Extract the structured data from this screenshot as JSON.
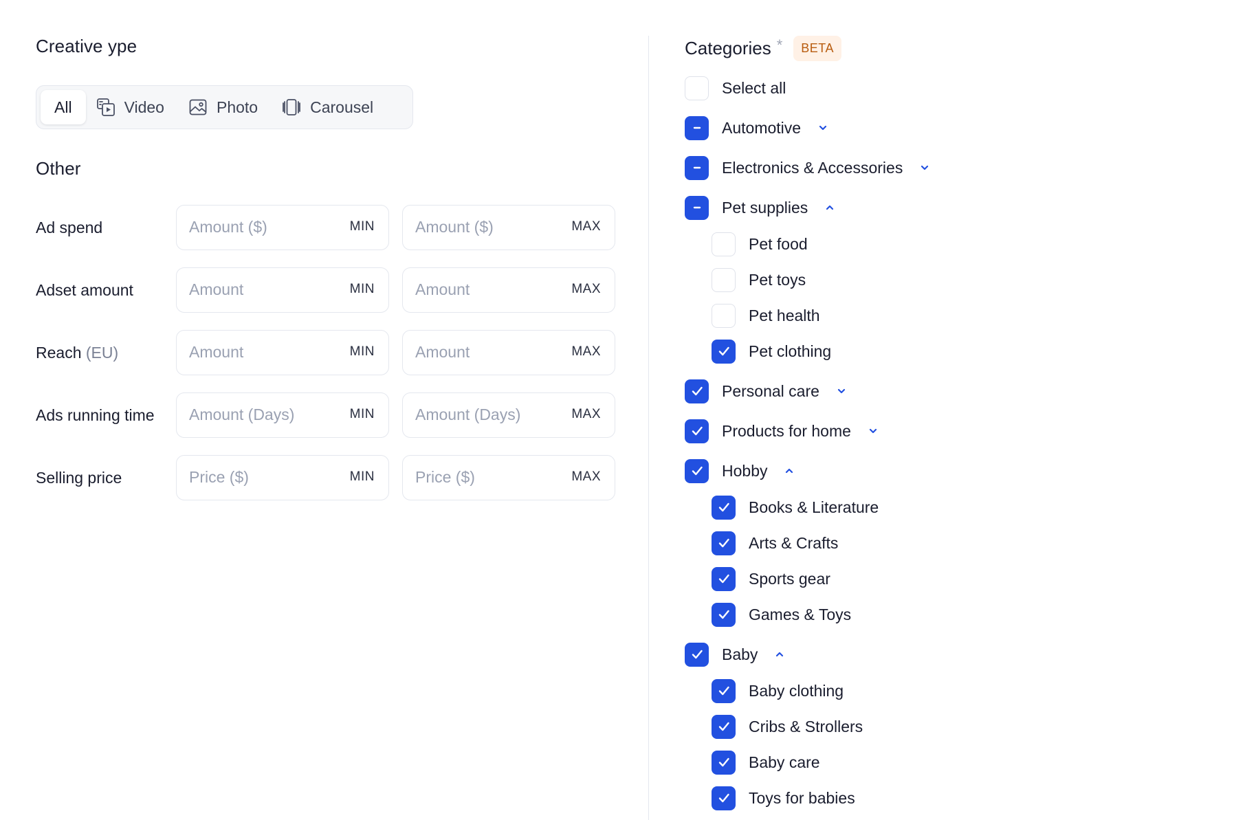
{
  "creative_type": {
    "title": "Creative ype",
    "options": [
      {
        "label": "All",
        "icon": "all",
        "active": true
      },
      {
        "label": "Video",
        "icon": "video-icon",
        "active": false
      },
      {
        "label": "Photo",
        "icon": "photo-icon",
        "active": false
      },
      {
        "label": "Carousel",
        "icon": "carousel-icon",
        "active": false
      }
    ]
  },
  "other": {
    "title": "Other",
    "rows": [
      {
        "label": "Ad spend",
        "label_suffix": "",
        "min_placeholder": "Amount ($)",
        "max_placeholder": "Amount ($)",
        "min_tag": "MIN",
        "max_tag": "MAX"
      },
      {
        "label": "Adset amount",
        "label_suffix": "",
        "min_placeholder": "Amount",
        "max_placeholder": "Amount",
        "min_tag": "MIN",
        "max_tag": "MAX"
      },
      {
        "label": "Reach",
        "label_suffix": "(EU)",
        "min_placeholder": "Amount",
        "max_placeholder": "Amount",
        "min_tag": "MIN",
        "max_tag": "MAX"
      },
      {
        "label": "Ads running time",
        "label_suffix": "",
        "min_placeholder": "Amount (Days)",
        "max_placeholder": "Amount (Days)",
        "min_tag": "MIN",
        "max_tag": "MAX"
      },
      {
        "label": "Selling price",
        "label_suffix": "",
        "min_placeholder": "Price ($)",
        "max_placeholder": "Price ($)",
        "min_tag": "MIN",
        "max_tag": "MAX"
      }
    ]
  },
  "categories": {
    "title": "Categories",
    "required_mark": "*",
    "badge": "BETA",
    "items": [
      {
        "label": "Select all",
        "state": "unchecked",
        "level": 0,
        "chevron": "none"
      },
      {
        "label": "Automotive",
        "state": "indeterminate",
        "level": 0,
        "chevron": "down"
      },
      {
        "label": "Electronics & Accessories",
        "state": "indeterminate",
        "level": 0,
        "chevron": "down"
      },
      {
        "label": "Pet supplies",
        "state": "indeterminate",
        "level": 0,
        "chevron": "up"
      },
      {
        "label": "Pet food",
        "state": "unchecked",
        "level": 1,
        "chevron": "none"
      },
      {
        "label": "Pet toys",
        "state": "unchecked",
        "level": 1,
        "chevron": "none"
      },
      {
        "label": "Pet health",
        "state": "unchecked",
        "level": 1,
        "chevron": "none"
      },
      {
        "label": "Pet clothing",
        "state": "checked",
        "level": 1,
        "chevron": "none"
      },
      {
        "label": "Personal care",
        "state": "checked",
        "level": 0,
        "chevron": "down"
      },
      {
        "label": "Products for home",
        "state": "checked",
        "level": 0,
        "chevron": "down"
      },
      {
        "label": "Hobby",
        "state": "checked",
        "level": 0,
        "chevron": "up"
      },
      {
        "label": "Books & Literature",
        "state": "checked",
        "level": 1,
        "chevron": "none"
      },
      {
        "label": "Arts & Crafts",
        "state": "checked",
        "level": 1,
        "chevron": "none"
      },
      {
        "label": "Sports gear",
        "state": "checked",
        "level": 1,
        "chevron": "none"
      },
      {
        "label": "Games & Toys",
        "state": "checked",
        "level": 1,
        "chevron": "none"
      },
      {
        "label": "Baby",
        "state": "checked",
        "level": 0,
        "chevron": "up"
      },
      {
        "label": "Baby clothing",
        "state": "checked",
        "level": 1,
        "chevron": "none"
      },
      {
        "label": "Cribs & Strollers",
        "state": "checked",
        "level": 1,
        "chevron": "none"
      },
      {
        "label": "Baby care",
        "state": "checked",
        "level": 1,
        "chevron": "none"
      },
      {
        "label": "Toys for babies",
        "state": "checked",
        "level": 1,
        "chevron": "none"
      }
    ]
  },
  "colors": {
    "accent": "#2250e0",
    "badge_bg": "#fff1e6",
    "badge_text": "#b85c0f",
    "border": "#e4e7ee",
    "placeholder": "#9aa1b2"
  }
}
